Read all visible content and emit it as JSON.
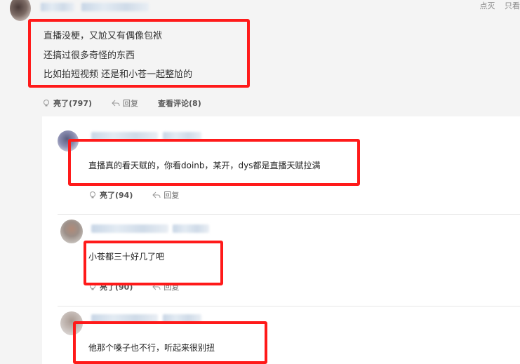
{
  "header": {
    "top_right_1": "点灭",
    "top_right_2": "只看"
  },
  "main_comment": {
    "lines": [
      "直播没梗，又尬又有偶像包袱",
      "还搞过很多奇怪的东西",
      "比如拍短视频 还是和小苍一起整尬的"
    ],
    "actions": {
      "like_label": "亮了(797)",
      "reply_label": "回复",
      "view_label": "查看评论(8)"
    }
  },
  "replies": [
    {
      "text": "直播真的看天赋的，你看doinb，某开，dys都是直播天赋拉满",
      "like_label": "亮了(94)",
      "reply_label": "回复"
    },
    {
      "text": "小苍都三十好几了吧",
      "like_label": "亮了(90)",
      "reply_label": "回复"
    },
    {
      "text": "他那个嗓子也不行，听起来很别扭"
    }
  ],
  "colors": {
    "highlight_box": "#ff1a1a",
    "panel_bg": "#f4f4f4",
    "reply_bg": "#ffffff"
  },
  "icons": {
    "like": "lightbulb-icon",
    "reply": "reply-arrow-icon"
  }
}
